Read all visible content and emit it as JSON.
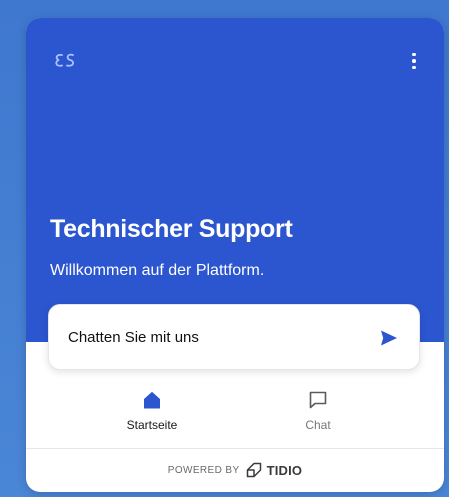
{
  "header": {
    "title": "Technischer Support",
    "subtitle": "Willkommen auf der Plattform.",
    "menu_icon": "more-vertical-icon",
    "logo_icon": "brand-logo-icon"
  },
  "chat_card": {
    "label": "Chatten Sie mit uns",
    "icon": "send-icon"
  },
  "nav": {
    "items": [
      {
        "label": "Startseite",
        "icon": "home-icon",
        "active": true
      },
      {
        "label": "Chat",
        "icon": "chat-bubble-icon",
        "active": false
      }
    ]
  },
  "footer": {
    "powered_by": "POWERED BY",
    "brand": "TIDIO"
  },
  "colors": {
    "hero_background": "#2c55d0",
    "page_background": "#4a86d6",
    "accent": "#2c55d0",
    "inactive_nav": "#777777"
  }
}
